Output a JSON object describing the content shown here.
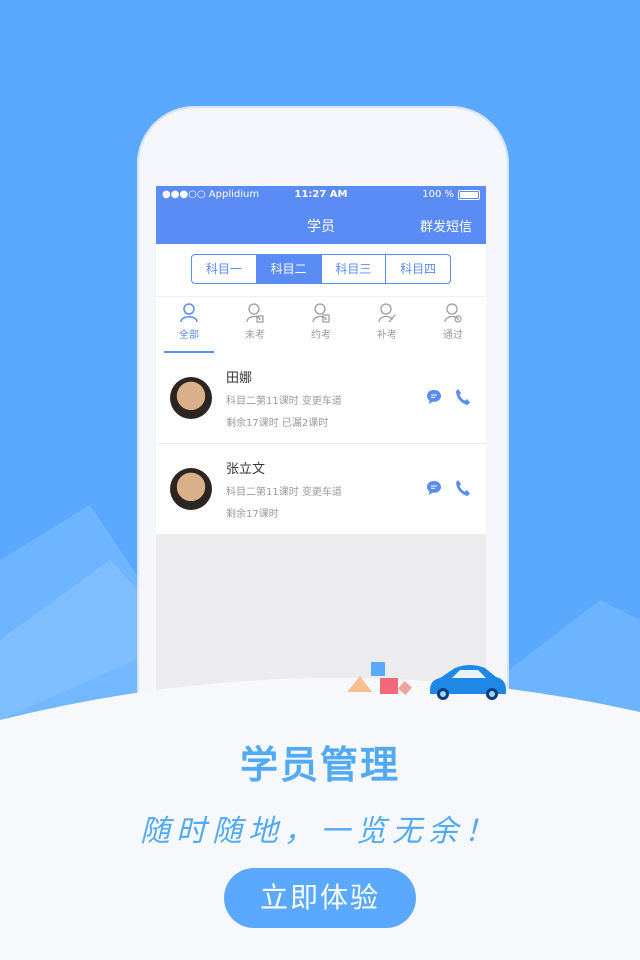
{
  "status_bar": {
    "carrier": "●●●○○ Applidium",
    "time": "11:27 AM",
    "battery": "100 %"
  },
  "nav": {
    "title": "学员",
    "action": "群发短信"
  },
  "segments": [
    "科目一",
    "科目二",
    "科目三",
    "科目四"
  ],
  "active_segment": 1,
  "filters": [
    "全部",
    "未考",
    "约考",
    "补考",
    "通过"
  ],
  "students": [
    {
      "name": "田娜",
      "line1": "科目二第11课时   变更车道",
      "line2": "剩余17课时   已漏2课时"
    },
    {
      "name": "张立文",
      "line1": "科目二第11课时   变更车道",
      "line2": "剩余17课时"
    }
  ],
  "promo": {
    "headline": "学员管理",
    "subline": "随时随地，一览无余！",
    "button": "立即体验"
  },
  "colors": {
    "background": "#5aa9ff",
    "accent": "#5b8cf6",
    "headline": "#52aaf5"
  }
}
